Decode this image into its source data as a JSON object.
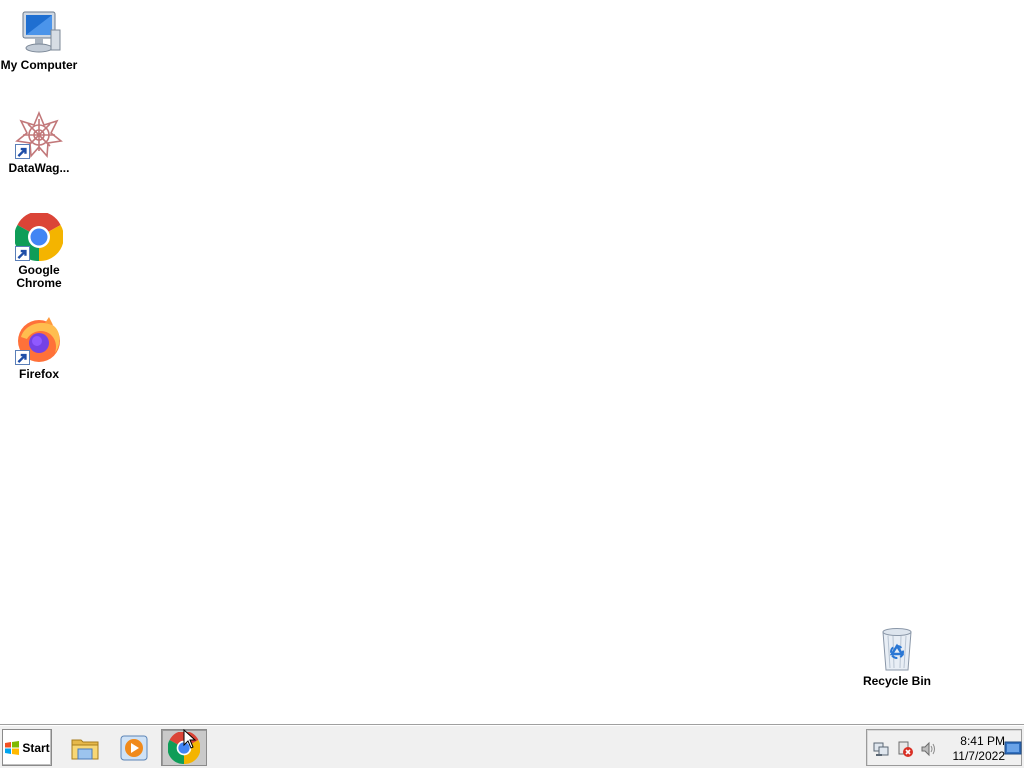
{
  "desktop": {
    "icons": [
      {
        "label": "My Computer",
        "icon": "my-computer-icon"
      },
      {
        "label": "DataWag...",
        "icon": "datawag-icon",
        "shortcut": true
      },
      {
        "label": "Google\nChrome",
        "icon": "chrome-icon",
        "shortcut": true
      },
      {
        "label": "Firefox",
        "icon": "firefox-icon",
        "shortcut": true
      },
      {
        "label": "Recycle Bin",
        "icon": "recycle-bin-icon"
      }
    ]
  },
  "taskbar": {
    "start_label": "Start",
    "pinned": [
      {
        "name": "File Explorer",
        "icon": "file-explorer-icon"
      },
      {
        "name": "Windows Media Player",
        "icon": "media-player-icon"
      },
      {
        "name": "Google Chrome",
        "icon": "chrome-icon",
        "active": true
      }
    ],
    "tray": {
      "icons": [
        "network-icon",
        "action-center-icon",
        "volume-icon",
        "show-desktop-icon"
      ],
      "time": "8:41 PM",
      "date": "11/7/2022"
    }
  },
  "colors": {
    "desktop_bg": "#ffffff",
    "taskbar_bg": "#f0f0f0",
    "chrome_red": "#db4437",
    "chrome_green": "#0f9d58",
    "chrome_yellow": "#f4b400",
    "chrome_blue": "#4285f4"
  }
}
